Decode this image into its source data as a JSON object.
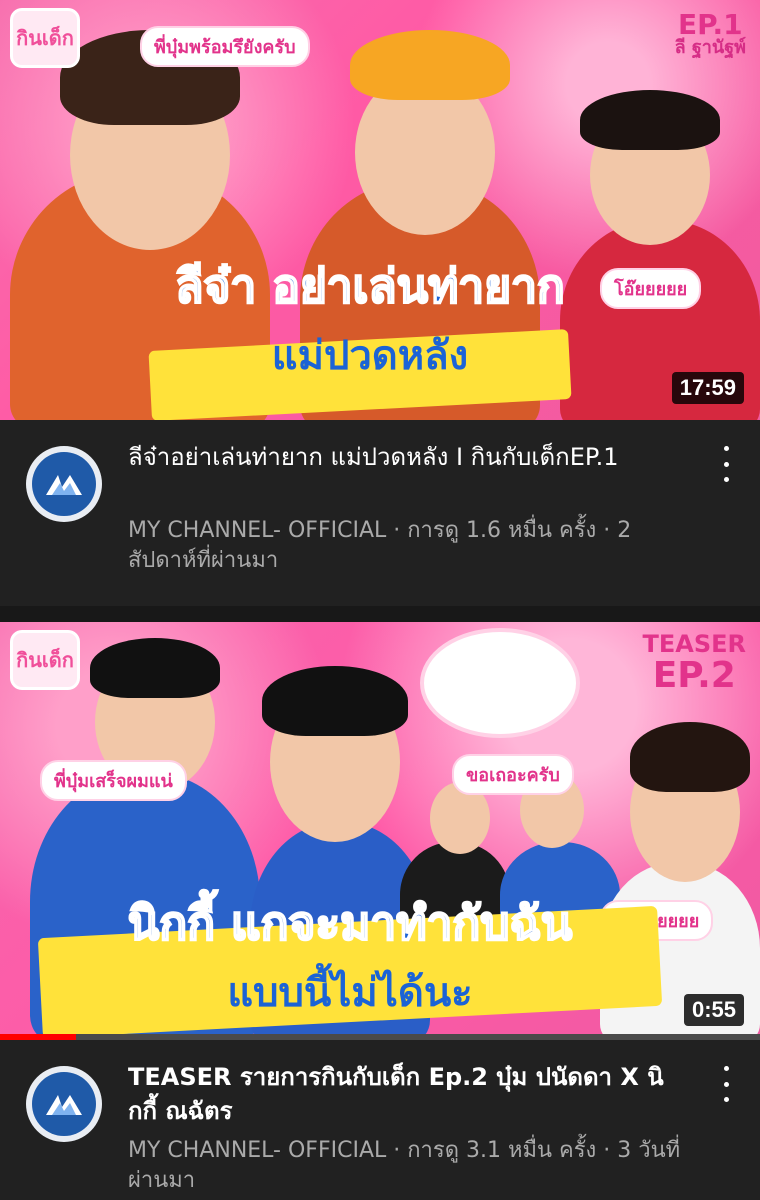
{
  "videos": [
    {
      "thumbnail": {
        "logo_text": "กินเด็ก",
        "ep_main": "EP.1",
        "ep_sub": "ลี ฐานัฐพ์",
        "bubble_top": "พี่บุ๋มพร้อมรึยังครับ",
        "bubble_right": "โอ๊ยยยยย",
        "headline_a": "ลีจ๋า อย่าเล่นท่ายาก",
        "headline_b": "แม่ปวดหลัง"
      },
      "duration": "17:59",
      "title": "ลีจ๋าอย่าเล่นท่ายาก แม่ปวดหลัง I กินกับเด็กEP.1",
      "channel_meta": "MY CHANNEL- OFFICIAL · การดู 1.6 หมื่น ครั้ง · 2 สัปดาห์ที่ผ่านมา",
      "watch_progress": 0
    },
    {
      "thumbnail": {
        "logo_text": "กินเด็ก",
        "ep_main": "TEASER",
        "ep_sub": "EP.2",
        "bubble_left": "พี่บุ๋มเสร็จผมแน่",
        "bubble_mid": "ขอเถอะครับ",
        "bubble_right": "ม่ายยยยยย",
        "headline_a": "นิกกี้ แกจะมาทำกับฉัน",
        "headline_b": "แบบนี้ไม่ได้นะ"
      },
      "duration": "0:55",
      "title": "TEASER รายการกินกับเด็ก  Ep.2 บุ๋ม ปนัดดา X นิกกี้ ณฉัตร",
      "channel_meta": "MY CHANNEL- OFFICIAL · การดู 3.1 หมื่น ครั้ง · 3 วันที่ผ่านมา",
      "watch_progress": 0.1
    }
  ],
  "icons": {
    "avatar": "channel-logo-icon",
    "more": "kebab-menu-icon"
  },
  "colors": {
    "background": "#212121",
    "secondary_text": "#aaaaaa",
    "progress": "#ff0000",
    "accent_pink": "#f05b9f"
  }
}
